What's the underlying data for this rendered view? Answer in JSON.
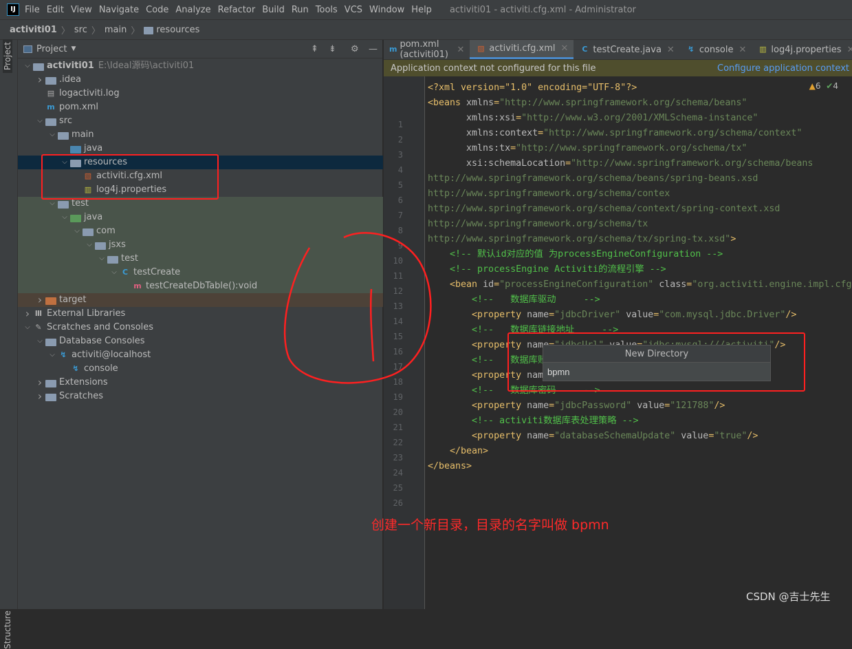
{
  "menubar": {
    "logo": "IJ",
    "items": [
      "File",
      "Edit",
      "View",
      "Navigate",
      "Code",
      "Analyze",
      "Refactor",
      "Build",
      "Run",
      "Tools",
      "VCS",
      "Window",
      "Help"
    ],
    "window_title": "activiti01 - activiti.cfg.xml - Administrator"
  },
  "breadcrumb": [
    "activiti01",
    "src",
    "main",
    "resources"
  ],
  "stripe": {
    "project": "Project",
    "structure": "Structure"
  },
  "panel": {
    "title": "Project"
  },
  "tree": [
    {
      "depth": 0,
      "arrow": "down",
      "icon": "module-folder",
      "label": "activiti01",
      "hint": "E:\\Ideal源码\\activiti01",
      "bold": true
    },
    {
      "depth": 1,
      "arrow": "right",
      "icon": "folder",
      "label": ".idea"
    },
    {
      "depth": 1,
      "arrow": "",
      "icon": "file",
      "label": "logactiviti.log"
    },
    {
      "depth": 1,
      "arrow": "",
      "icon": "maven",
      "label": "pom.xml"
    },
    {
      "depth": 1,
      "arrow": "down",
      "icon": "folder",
      "label": "src"
    },
    {
      "depth": 2,
      "arrow": "down",
      "icon": "folder",
      "label": "main"
    },
    {
      "depth": 3,
      "arrow": "",
      "icon": "source-folder",
      "label": "java"
    },
    {
      "depth": 3,
      "arrow": "down",
      "icon": "resources-folder",
      "label": "resources",
      "bg": "selected"
    },
    {
      "depth": 4,
      "arrow": "",
      "icon": "xml-file",
      "label": "activiti.cfg.xml"
    },
    {
      "depth": 4,
      "arrow": "",
      "icon": "properties-file",
      "label": "log4j.properties"
    },
    {
      "depth": 2,
      "arrow": "down",
      "icon": "folder",
      "label": "test",
      "bg": "test"
    },
    {
      "depth": 3,
      "arrow": "down",
      "icon": "test-folder",
      "label": "java",
      "bg": "test"
    },
    {
      "depth": 4,
      "arrow": "down",
      "icon": "package",
      "label": "com",
      "bg": "test"
    },
    {
      "depth": 5,
      "arrow": "down",
      "icon": "package",
      "label": "jsxs",
      "bg": "test"
    },
    {
      "depth": 6,
      "arrow": "down",
      "icon": "package",
      "label": "test",
      "bg": "test"
    },
    {
      "depth": 7,
      "arrow": "down",
      "icon": "class",
      "label": "testCreate",
      "bg": "test"
    },
    {
      "depth": 8,
      "arrow": "",
      "icon": "method",
      "label": "testCreateDbTable():void",
      "bg": "test"
    },
    {
      "depth": 1,
      "arrow": "right",
      "icon": "excluded-folder",
      "label": "target",
      "bg": "target"
    },
    {
      "depth": 0,
      "arrow": "right",
      "icon": "libraries",
      "label": "External Libraries"
    },
    {
      "depth": 0,
      "arrow": "down",
      "icon": "scratches",
      "label": "Scratches and Consoles"
    },
    {
      "depth": 1,
      "arrow": "down",
      "icon": "folder",
      "label": "Database Consoles"
    },
    {
      "depth": 2,
      "arrow": "down",
      "icon": "database",
      "label": "activiti@localhost"
    },
    {
      "depth": 3,
      "arrow": "",
      "icon": "console",
      "label": "console"
    },
    {
      "depth": 1,
      "arrow": "right",
      "icon": "folder",
      "label": "Extensions"
    },
    {
      "depth": 1,
      "arrow": "right",
      "icon": "folder",
      "label": "Scratches"
    }
  ],
  "tabs": [
    {
      "icon": "maven-icon",
      "label": "pom.xml (activiti01)"
    },
    {
      "icon": "xml-spring-icon",
      "label": "activiti.cfg.xml",
      "active": true
    },
    {
      "icon": "class-icon",
      "label": "testCreate.java"
    },
    {
      "icon": "console-icon",
      "label": "console"
    },
    {
      "icon": "properties-icon",
      "label": "log4j.properties"
    }
  ],
  "banner": {
    "text": "Application context not configured for this file",
    "link": "Configure application context"
  },
  "inspections": {
    "warnings": "6",
    "weak_warnings": "4"
  },
  "code": [
    [
      [
        "t",
        "<?xml version=\"1.0\" encoding=\"UTF-8\"?>"
      ]
    ],
    [
      [
        "t",
        "<beans "
      ],
      [
        "a",
        "xmlns"
      ],
      [
        "t",
        "="
      ],
      [
        "v",
        "\"http://www.springframework.org/schema/beans\""
      ]
    ],
    [
      [
        "a",
        "       xmlns:xsi"
      ],
      [
        "t",
        "="
      ],
      [
        "v",
        "\"http://www.w3.org/2001/XMLSchema-instance\""
      ]
    ],
    [
      [
        "a",
        "       xmlns:context"
      ],
      [
        "t",
        "="
      ],
      [
        "v",
        "\"http://www.springframework.org/schema/context\""
      ]
    ],
    [
      [
        "a",
        "       xmlns:tx"
      ],
      [
        "t",
        "="
      ],
      [
        "v",
        "\"http://www.springframework.org/schema/tx\""
      ]
    ],
    [
      [
        "a",
        "       xsi:schemaLocation"
      ],
      [
        "t",
        "="
      ],
      [
        "v",
        "\"http://www.springframework.org/schema/beans"
      ]
    ],
    [
      [
        "v",
        "http://www.springframework.org/schema/beans/spring-beans.xsd"
      ]
    ],
    [
      [
        "v",
        "http://www.springframework.org/schema/contex"
      ]
    ],
    [
      [
        "v",
        "http://www.springframework.org/schema/context/spring-context.xsd"
      ]
    ],
    [
      [
        "v",
        "http://www.springframework.org/schema/tx"
      ]
    ],
    [
      [
        "v",
        "http://www.springframework.org/schema/tx/spring-tx.xsd\""
      ],
      [
        "t",
        ">"
      ]
    ],
    [
      [
        "c",
        "    <!-- 默认id对应的值 为processEngineConfiguration -->"
      ]
    ],
    [
      [
        "c",
        "    <!-- processEngine Activiti的流程引擎 -->"
      ]
    ],
    [
      [
        "t",
        "    <bean "
      ],
      [
        "a",
        "id"
      ],
      [
        "t",
        "="
      ],
      [
        "v",
        "\"processEngineConfiguration\" "
      ],
      [
        "a",
        "class"
      ],
      [
        "t",
        "="
      ],
      [
        "v",
        "\"org.activiti.engine.impl.cfg"
      ]
    ],
    [
      [
        "c",
        "        <!--   数据库驱动     -->"
      ]
    ],
    [
      [
        "t",
        "        <property "
      ],
      [
        "a",
        "name"
      ],
      [
        "t",
        "="
      ],
      [
        "v",
        "\"jdbcDriver\" "
      ],
      [
        "a",
        "value"
      ],
      [
        "t",
        "="
      ],
      [
        "v",
        "\"com.mysql.jdbc.Driver\""
      ],
      [
        "t",
        "/>"
      ]
    ],
    [
      [
        "c",
        "        <!--   数据库链接地址     -->"
      ]
    ],
    [
      [
        "t",
        "        <property "
      ],
      [
        "a",
        "name"
      ],
      [
        "t",
        "="
      ],
      [
        "v",
        "\"jdbcUrl\" "
      ],
      [
        "a",
        "value"
      ],
      [
        "t",
        "="
      ],
      [
        "v",
        "\"jdbc:mysql:///activiti\""
      ],
      [
        "t",
        "/>"
      ]
    ],
    [
      [
        "c",
        "        <!--   数据库账"
      ]
    ],
    [
      [
        "t",
        "        <property "
      ],
      [
        "a",
        "nam"
      ]
    ],
    [
      [
        "c",
        "        <!--   数据库密码     -->"
      ]
    ],
    [
      [
        "t",
        "        <property "
      ],
      [
        "a",
        "name"
      ],
      [
        "t",
        "="
      ],
      [
        "v",
        "\"jdbcPassword\" "
      ],
      [
        "a",
        "value"
      ],
      [
        "t",
        "="
      ],
      [
        "v",
        "\"121788\""
      ],
      [
        "t",
        "/>"
      ]
    ],
    [
      [
        "c",
        "        <!-- activiti数据库表处理策略 -->"
      ]
    ],
    [
      [
        "t",
        "        <property "
      ],
      [
        "a",
        "name"
      ],
      [
        "t",
        "="
      ],
      [
        "v",
        "\"databaseSchemaUpdate\" "
      ],
      [
        "a",
        "value"
      ],
      [
        "t",
        "="
      ],
      [
        "v",
        "\"true\""
      ],
      [
        "t",
        "/>"
      ]
    ],
    [
      [
        "t",
        "    </bean>"
      ]
    ],
    [
      [
        "t",
        "</beans>"
      ]
    ]
  ],
  "dialog": {
    "title": "New Directory",
    "value": "bpmn"
  },
  "annotation": {
    "note": "创建一个新目录，目录的名字叫做 bpmn",
    "color": "#ff2020"
  },
  "watermark": "CSDN @吉士先生"
}
